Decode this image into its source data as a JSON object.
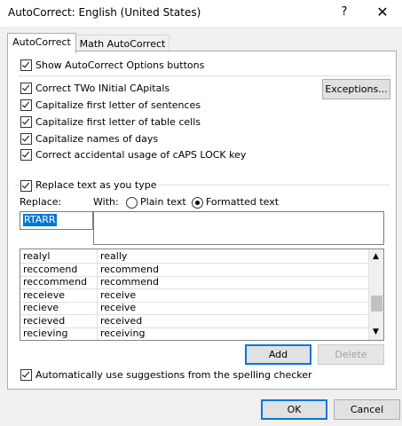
{
  "window": {
    "title": "AutoCorrect: English (United States)",
    "help_glyph": "?",
    "close_glyph": "✕"
  },
  "tabs": [
    {
      "label": "AutoCorrect",
      "active": true
    },
    {
      "label": "Math AutoCorrect",
      "active": false
    }
  ],
  "options": {
    "show_buttons": "Show AutoCorrect Options buttons",
    "correct_two_initial": "Correct TWo INitial CApitals",
    "cap_sentences": "Capitalize first letter of sentences",
    "cap_table_cells": "Capitalize first letter of table cells",
    "cap_days": "Capitalize names of days",
    "correct_caps_lock": "Correct accidental usage of cAPS LOCK key",
    "exceptions_button": "Exceptions...",
    "replace_as_you_type": "Replace text as you type",
    "replace_label": "Replace:",
    "with_label": "With:",
    "plain_text": "Plain text",
    "formatted_text": "Formatted text",
    "replace_value": "RTARR",
    "with_value": ""
  },
  "entries": [
    {
      "from": "realyl",
      "to": "really"
    },
    {
      "from": "reccomend",
      "to": "recommend"
    },
    {
      "from": "reccommend",
      "to": "recommend"
    },
    {
      "from": "receieve",
      "to": "receive"
    },
    {
      "from": "recieve",
      "to": "receive"
    },
    {
      "from": "recieved",
      "to": "received"
    },
    {
      "from": "recieving",
      "to": "receiving"
    }
  ],
  "buttons": {
    "add": "Add",
    "delete": "Delete",
    "ok": "OK",
    "cancel": "Cancel"
  },
  "spelling_option": "Automatically use suggestions from the spelling checker",
  "colors": {
    "accent": "#0078d7",
    "dialog_bg": "#f0f0f0"
  }
}
